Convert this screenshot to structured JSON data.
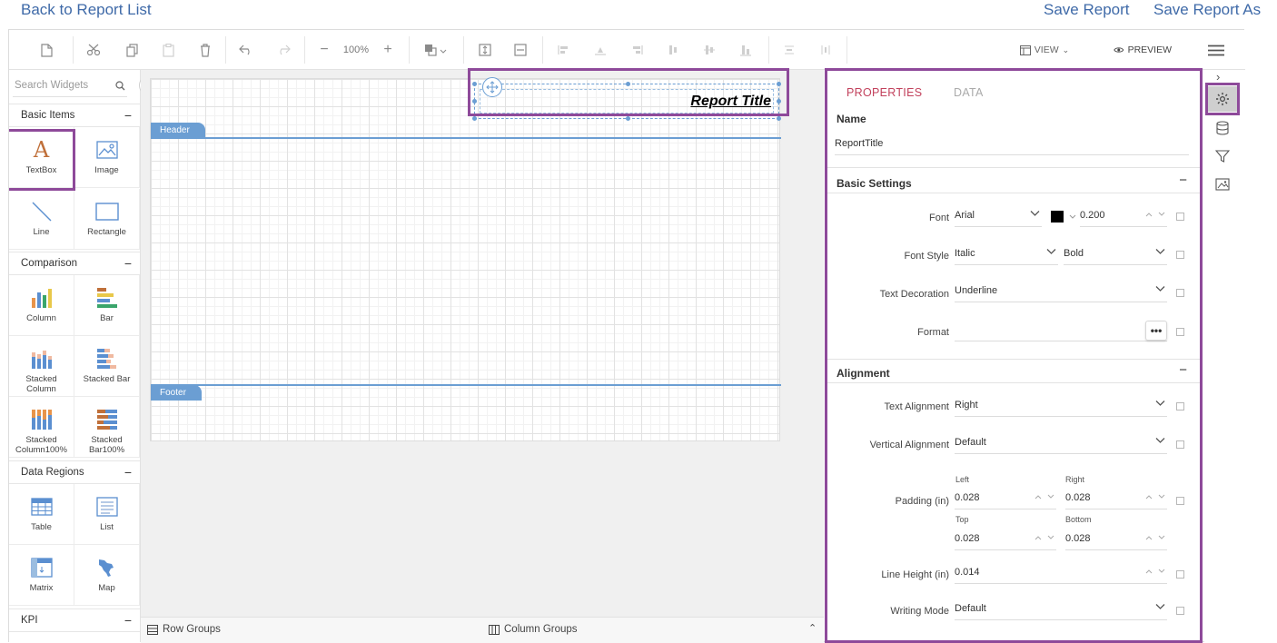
{
  "nav": {
    "back": "Back to Report List",
    "save": "Save Report",
    "save_as": "Save Report As"
  },
  "toolbar": {
    "zoom": "100%",
    "view": "VIEW",
    "preview": "PREVIEW"
  },
  "widgets": {
    "search_placeholder": "Search Widgets",
    "categories": {
      "basic": "Basic Items",
      "comparison": "Comparison",
      "data_regions": "Data Regions",
      "kpi": "KPI"
    },
    "items": {
      "textbox": "TextBox",
      "image": "Image",
      "line": "Line",
      "rectangle": "Rectangle",
      "column": "Column",
      "bar": "Bar",
      "stacked_column_1": "Stacked",
      "stacked_column_2": "Column",
      "stacked_bar": "Stacked Bar",
      "stacked_col100_1": "Stacked",
      "stacked_col100_2": "Column100%",
      "stacked_bar100_1": "Stacked",
      "stacked_bar100_2": "Bar100%",
      "table": "Table",
      "list": "List",
      "matrix": "Matrix",
      "map": "Map"
    }
  },
  "canvas": {
    "header_band": "Header",
    "footer_band": "Footer",
    "textbox_value": "Report Title",
    "row_groups": "Row Groups",
    "column_groups": "Column Groups"
  },
  "properties": {
    "tab_properties": "PROPERTIES",
    "tab_data": "DATA",
    "name_label": "Name",
    "name_value": "ReportTitle",
    "basic_settings": "Basic Settings",
    "font_label": "Font",
    "font_value": "Arial",
    "font_color": "#000000",
    "font_size": "0.200",
    "font_style_label": "Font Style",
    "font_style_value": "Italic",
    "font_weight_value": "Bold",
    "text_decoration_label": "Text Decoration",
    "text_decoration_value": "Underline",
    "format_label": "Format",
    "format_value": "",
    "alignment": "Alignment",
    "text_alignment_label": "Text Alignment",
    "text_alignment_value": "Right",
    "vertical_alignment_label": "Vertical Alignment",
    "vertical_alignment_value": "Default",
    "padding_label": "Padding (in)",
    "pad_left_label": "Left",
    "pad_left": "0.028",
    "pad_right_label": "Right",
    "pad_right": "0.028",
    "pad_top_label": "Top",
    "pad_top": "0.028",
    "pad_bottom_label": "Bottom",
    "pad_bottom": "0.028",
    "line_height_label": "Line Height (in)",
    "line_height_value": "0.014",
    "writing_mode_label": "Writing Mode",
    "writing_mode_value": "Default"
  },
  "colors": {
    "accent_tab": "#c2415c",
    "highlight": "#8e4a9a",
    "band": "#6b9ed3",
    "link": "#3f6aa8"
  }
}
